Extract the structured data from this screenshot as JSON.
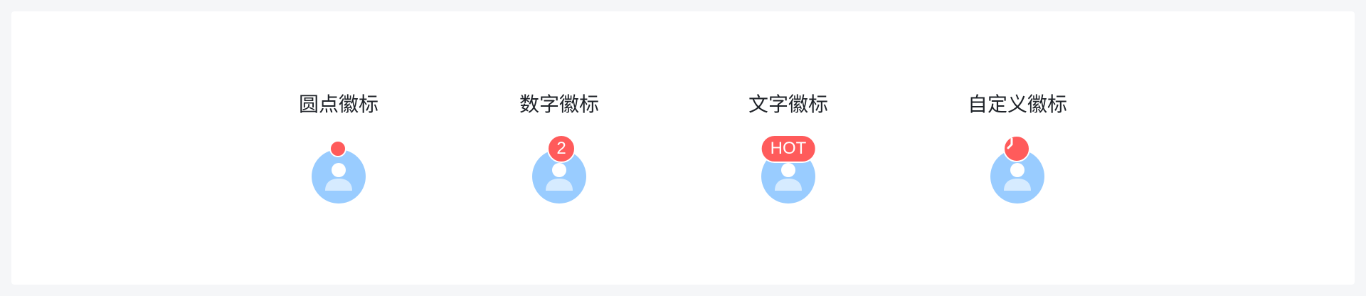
{
  "colors": {
    "page_background": "#f5f6f8",
    "card_background": "#ffffff",
    "title_text": "#1f2329",
    "avatar": "#99ccff",
    "badge": "#ff5b5b"
  },
  "demos": [
    {
      "title": "圆点徽标",
      "badge_type": "dot",
      "icon": "user-icon"
    },
    {
      "title": "数字徽标",
      "badge_type": "count",
      "badge_value": "2",
      "icon": "user-icon"
    },
    {
      "title": "文字徽标",
      "badge_type": "text",
      "badge_value": "HOT",
      "icon": "user-icon"
    },
    {
      "title": "自定义徽标",
      "badge_type": "custom",
      "badge_icon": "clock-icon",
      "icon": "user-icon"
    }
  ]
}
